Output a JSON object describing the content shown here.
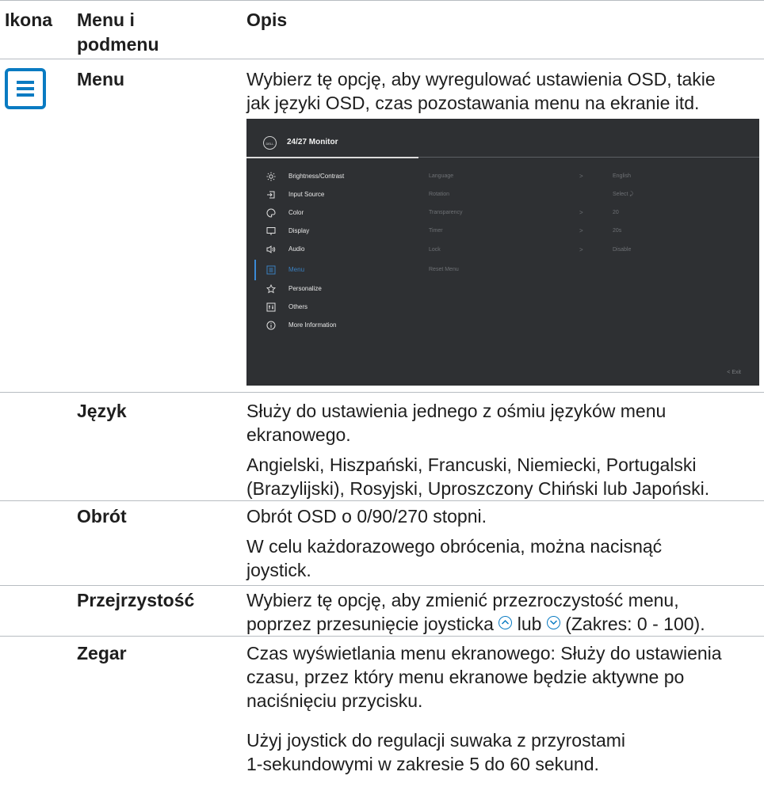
{
  "header": {
    "col_icon": "Ikona",
    "col_menu_l1": "Menu i",
    "col_menu_l2": "podmenu",
    "col_desc": "Opis"
  },
  "menu_row": {
    "icon": "menu-list-icon",
    "label": "Menu",
    "desc_l1": "Wybierz tę opcję, aby wyregulować ustawienia OSD, takie",
    "desc_l2": "jak języki OSD, czas pozostawania menu na ekranie itd."
  },
  "osd": {
    "logo": "DELL",
    "title": "24/27 Monitor",
    "items": [
      {
        "icon": "brightness-icon",
        "label": "Brightness/Contrast"
      },
      {
        "icon": "input-source-icon",
        "label": "Input Source"
      },
      {
        "icon": "color-icon",
        "label": "Color"
      },
      {
        "icon": "display-icon",
        "label": "Display"
      },
      {
        "icon": "audio-icon",
        "label": "Audio"
      },
      {
        "icon": "menu-icon",
        "label": "Menu"
      },
      {
        "icon": "star-icon",
        "label": "Personalize"
      },
      {
        "icon": "others-icon",
        "label": "Others"
      },
      {
        "icon": "info-icon",
        "label": "More Information"
      }
    ],
    "active_item": "Menu",
    "submenu": [
      {
        "label": "Language",
        "arrow": ">",
        "value": "English"
      },
      {
        "label": "Rotation",
        "arrow": "",
        "value": "Select ⤸"
      },
      {
        "label": "Transparency",
        "arrow": ">",
        "value": "20"
      },
      {
        "label": "Timer",
        "arrow": ">",
        "value": "20s"
      },
      {
        "label": "Lock",
        "arrow": ">",
        "value": "Disable"
      },
      {
        "label": "Reset Menu",
        "arrow": "",
        "value": ""
      }
    ],
    "exit": "<  Exit"
  },
  "rows": {
    "jezyk": {
      "label": "Język",
      "d1": "Służy do ustawienia jednego z ośmiu języków menu",
      "d2": "ekranowego.",
      "d3": "Angielski, Hiszpański, Francuski, Niemiecki, Portugalski",
      "d4": "(Brazylijski), Rosyjski, Uproszczony Chiński lub Japoński."
    },
    "obrot": {
      "label": "Obrót",
      "d1": "Obrót OSD o 0/90/270 stopni.",
      "d2": "W celu każdorazowego obrócenia, można nacisnąć",
      "d3": "joystick."
    },
    "przejrzystosc": {
      "label": "Przejrzystość",
      "d1": "Wybierz tę opcję, aby zmienić przezroczystość menu,",
      "d2a": "poprzez przesunięcie joysticka ",
      "d2b": " lub ",
      "d2c": " (Zakres: 0 - 100)."
    },
    "zegar": {
      "label": "Zegar",
      "d1": "Czas wyświetlania menu ekranowego: Służy do ustawienia",
      "d2": "czasu, przez który menu ekranowe będzie aktywne po",
      "d3": "naciśnięciu przycisku.",
      "d4": "Użyj joystick do regulacji suwaka z przyrostami",
      "d5": "1-sekundowymi w zakresie 5 do 60 sekund."
    }
  },
  "colors": {
    "accent": "#0a7bc2",
    "osd_bg": "#2e3033",
    "rule": "#b7bcc1"
  }
}
